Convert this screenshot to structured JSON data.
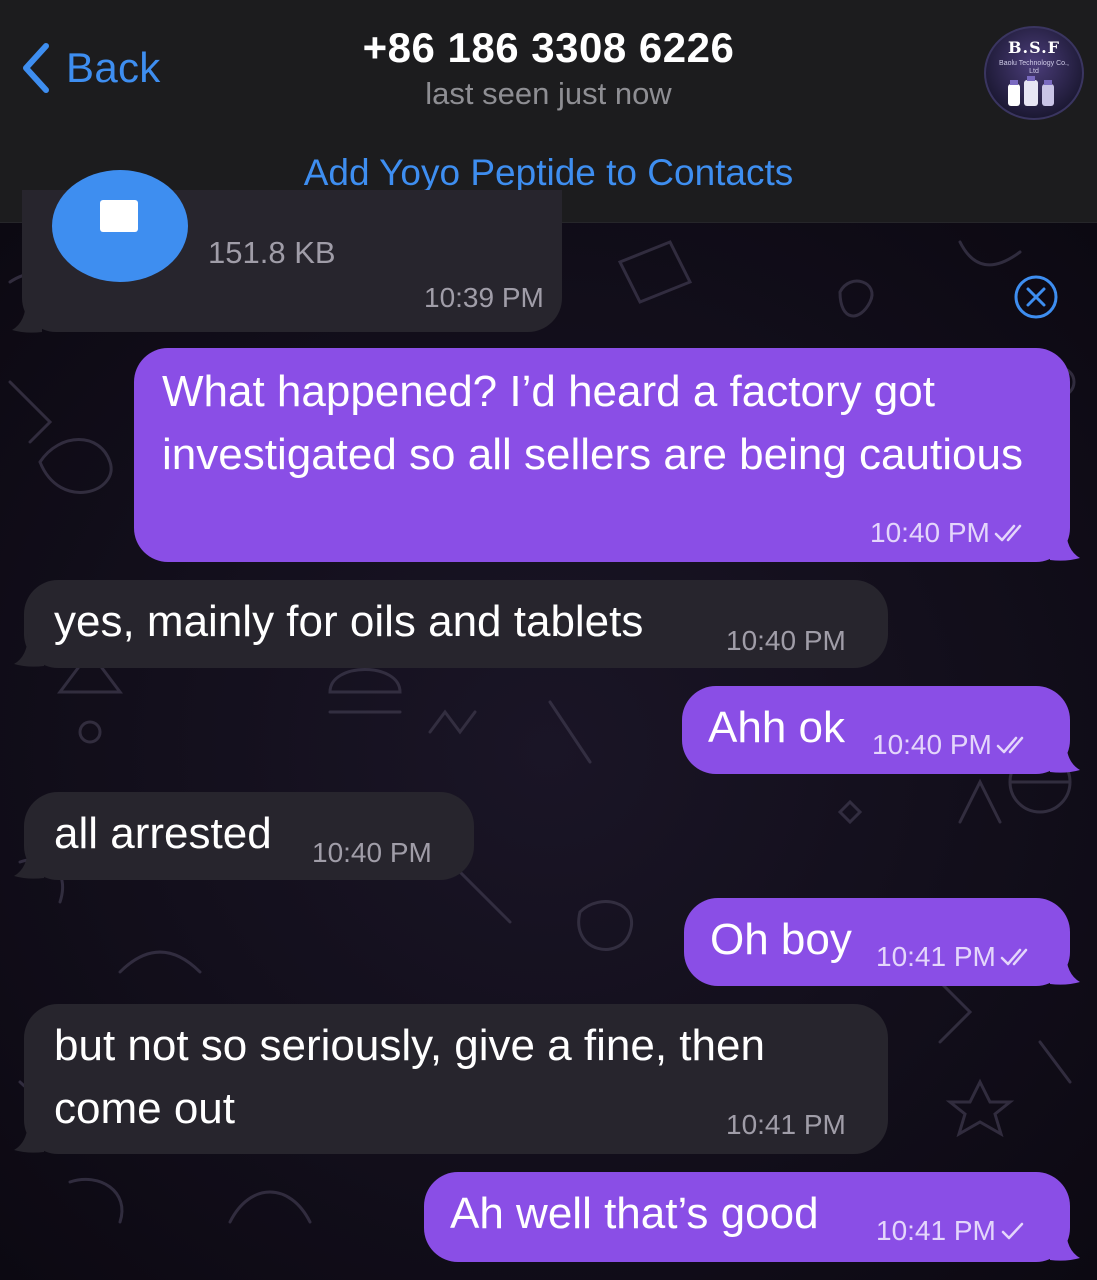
{
  "header": {
    "back_label": "Back",
    "contact_title": "+86 186 3308 6226",
    "status": "last seen just now",
    "avatar_logo": "B.S.F",
    "avatar_sub": "Baolu Technology Co., Ltd"
  },
  "add_contact_bar": {
    "label": "Add Yoyo Peptide to Contacts"
  },
  "messages": [
    {
      "direction": "incoming",
      "type": "file",
      "size": "151.8 KB",
      "time": "10:39 PM"
    },
    {
      "direction": "outgoing",
      "text": "What happened?  I’d heard a factory got investigated so all sellers are being cautious",
      "time": "10:40 PM",
      "read": true
    },
    {
      "direction": "incoming",
      "text": "yes, mainly for oils and tablets",
      "time": "10:40 PM"
    },
    {
      "direction": "outgoing",
      "text": "Ahh ok",
      "time": "10:40 PM",
      "read": true
    },
    {
      "direction": "incoming",
      "text": "all arrested",
      "time": "10:40 PM"
    },
    {
      "direction": "outgoing",
      "text": "Oh boy",
      "time": "10:41 PM",
      "read": true
    },
    {
      "direction": "incoming",
      "text": "but not so seriously, give a fine, then come out",
      "time": "10:41 PM"
    },
    {
      "direction": "outgoing",
      "text": "Ah well that’s good",
      "time": "10:41 PM",
      "read": false
    }
  ],
  "colors": {
    "accent": "#3e8ef0",
    "outgoing_bubble": "#8a4ee6",
    "incoming_bubble": "#27252d",
    "header_bg": "#1c1c1e"
  }
}
